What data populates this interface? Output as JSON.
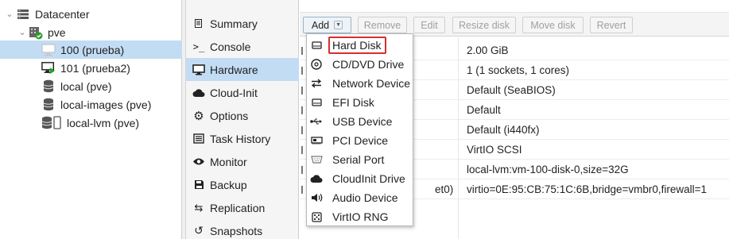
{
  "tree": {
    "items": [
      {
        "label": "Datacenter",
        "icon": "server-stack-icon",
        "expander": "⌄"
      },
      {
        "label": "pve",
        "icon": "node-online-icon",
        "expander": "⌄"
      },
      {
        "label": "100 (prueba)",
        "icon": "vm-stopped-icon",
        "expander": ""
      },
      {
        "label": "101 (prueba2)",
        "icon": "vm-running-icon",
        "expander": ""
      },
      {
        "label": "local (pve)",
        "icon": "storage-icon",
        "expander": ""
      },
      {
        "label": "local-images (pve)",
        "icon": "storage-icon",
        "expander": ""
      },
      {
        "label": "local-lvm (pve)",
        "icon": "storage-lvm-icon",
        "expander": ""
      }
    ],
    "selected_index": 2
  },
  "nav": {
    "items": [
      {
        "label": "Summary",
        "icon": "book-icon"
      },
      {
        "label": "Console",
        "icon": "terminal-icon"
      },
      {
        "label": "Hardware",
        "icon": "monitor-icon"
      },
      {
        "label": "Cloud-Init",
        "icon": "cloud-icon"
      },
      {
        "label": "Options",
        "icon": "gear-icon"
      },
      {
        "label": "Task History",
        "icon": "list-icon"
      },
      {
        "label": "Monitor",
        "icon": "eye-icon"
      },
      {
        "label": "Backup",
        "icon": "floppy-icon"
      },
      {
        "label": "Replication",
        "icon": "retweet-icon"
      },
      {
        "label": "Snapshots",
        "icon": "history-icon"
      }
    ],
    "active_index": 2
  },
  "toolbar": {
    "add_label": "Add",
    "remove_label": "Remove",
    "edit_label": "Edit",
    "resize_label": "Resize disk",
    "move_label": "Move disk",
    "revert_label": "Revert",
    "caret": "▼"
  },
  "hardware": {
    "rows": [
      {
        "key": "",
        "value": "2.00 GiB"
      },
      {
        "key": "",
        "value": "1 (1 sockets, 1 cores)"
      },
      {
        "key": "",
        "value": "Default (SeaBIOS)"
      },
      {
        "key": "",
        "value": "Default"
      },
      {
        "key": "",
        "value": "Default (i440fx)"
      },
      {
        "key": "",
        "value": "VirtIO SCSI"
      },
      {
        "key": "",
        "value": "local-lvm:vm-100-disk-0,size=32G"
      },
      {
        "key": "et0)",
        "value": "virtio=0E:95:CB:75:1C:6B,bridge=vmbr0,firewall=1"
      }
    ]
  },
  "add_menu": {
    "items": [
      {
        "label": "Hard Disk",
        "icon": "hdd-icon",
        "glyph": "▭"
      },
      {
        "label": "CD/DVD Drive",
        "icon": "cd-icon",
        "glyph": "◎"
      },
      {
        "label": "Network Device",
        "icon": "exchange-icon",
        "glyph": "⇄"
      },
      {
        "label": "EFI Disk",
        "icon": "hdd-icon",
        "glyph": "▭"
      },
      {
        "label": "USB Device",
        "icon": "usb-icon",
        "glyph": "⭅"
      },
      {
        "label": "PCI Device",
        "icon": "pci-card-icon",
        "glyph": "▤"
      },
      {
        "label": "Serial Port",
        "icon": "serial-port-icon",
        "glyph": "▥"
      },
      {
        "label": "CloudInit Drive",
        "icon": "cloud-icon",
        "glyph": "☁"
      },
      {
        "label": "Audio Device",
        "icon": "speaker-icon",
        "glyph": "🔊"
      },
      {
        "label": "VirtIO RNG",
        "icon": "dice-icon",
        "glyph": "⚄"
      }
    ],
    "highlighted_index": 0,
    "highlight_color": "#d32f2f"
  },
  "colors": {
    "selection": "#c2dcf4",
    "status_green": "#2e9b2e",
    "running_arrow": "#21a321"
  }
}
